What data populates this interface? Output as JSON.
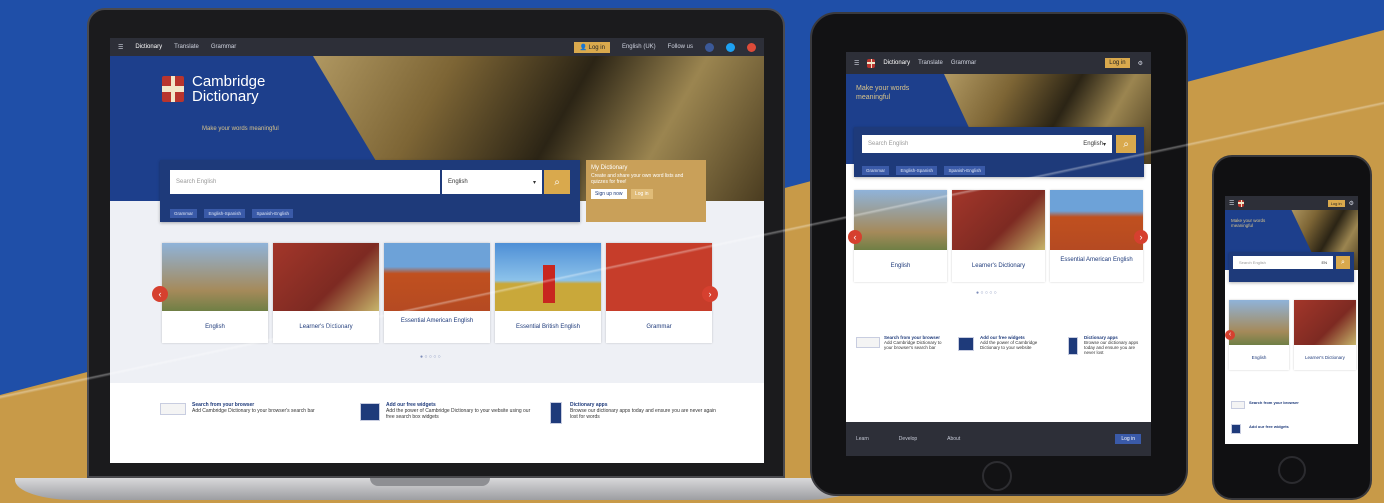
{
  "colors": {
    "blue_bg": "#1f4fa8",
    "gold_bg": "#c89a48",
    "brand_blue": "#1d3f8c",
    "accent_gold": "#d9a94d",
    "arrow_red": "#d6402f"
  },
  "laptop": {
    "nav": {
      "menu_icon": "menu-icon",
      "items": [
        "Dictionary",
        "Translate",
        "Grammar"
      ],
      "login": "Log in",
      "language": "English (UK)",
      "follow": "Follow us"
    },
    "brand": {
      "line1": "Cambridge",
      "line2": "Dictionary",
      "tagline": "Make your words meaningful"
    },
    "search": {
      "placeholder": "Search English",
      "dropdown": "English",
      "chips": [
        "Grammar",
        "English-Spanish",
        "Spanish-English"
      ]
    },
    "my_dictionary": {
      "title": "My Dictionary",
      "text": "Create and share your own word lists and quizzes for free!",
      "signup": "Sign up now",
      "login": "Log in"
    },
    "cards": [
      "English",
      "Learner's Dictionary",
      "Essential American English",
      "Essential British English",
      "Grammar"
    ],
    "features": [
      {
        "title": "Search from your browser",
        "text": "Add Cambridge Dictionary to your browser's search bar"
      },
      {
        "title": "Add our free widgets",
        "text": "Add the power of Cambridge Dictionary to your website using our free search box widgets"
      },
      {
        "title": "Dictionary apps",
        "text": "Browse our dictionary apps today and ensure you are never again lost for words"
      }
    ]
  },
  "tablet": {
    "nav": {
      "items": [
        "Dictionary",
        "Translate",
        "Grammar"
      ],
      "login": "Log in"
    },
    "tagline_1": "Make your words",
    "tagline_2": "meaningful",
    "search": {
      "placeholder": "Search English",
      "dropdown": "English",
      "chips": [
        "Grammar",
        "English-Spanish",
        "Spanish-English"
      ]
    },
    "cards": [
      "English",
      "Learner's Dictionary",
      "Essential American English"
    ],
    "features": [
      {
        "title": "Search from your browser",
        "text": "Add Cambridge Dictionary to your browser's search bar"
      },
      {
        "title": "Add our free widgets",
        "text": "Add the power of Cambridge Dictionary to your website"
      },
      {
        "title": "Dictionary apps",
        "text": "Browse our dictionary apps today and ensure you are never lost"
      }
    ],
    "footer": {
      "items": [
        "Learn",
        "Develop",
        "About"
      ],
      "login": "Log in"
    }
  },
  "phone": {
    "nav": {
      "login": "Log in"
    },
    "tagline": "Make your words meaningful",
    "search": {
      "placeholder": "Search English",
      "dropdown": "EN"
    },
    "cards": [
      "English",
      "Learner's Dictionary"
    ],
    "features": [
      {
        "title": "Search from your browser"
      },
      {
        "title": "Add our free widgets"
      }
    ]
  }
}
